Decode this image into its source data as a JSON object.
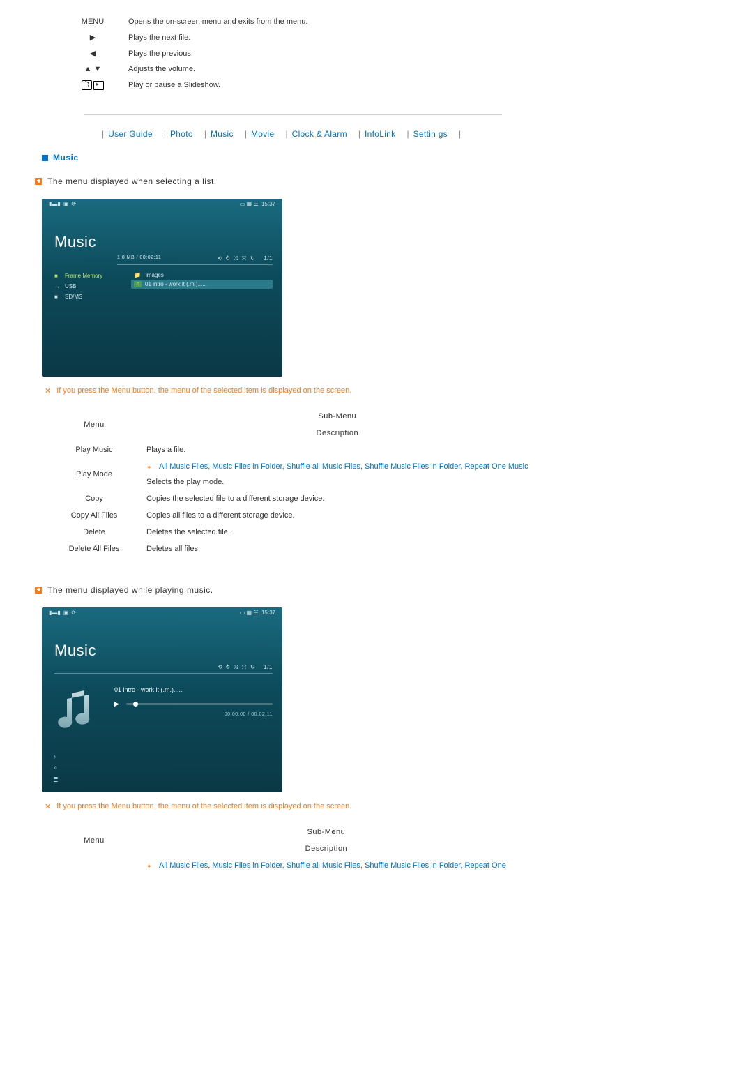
{
  "buttons_table": [
    {
      "icon_label": "MENU",
      "is_text": true,
      "desc": "Opens the on-screen menu and exits from the menu."
    },
    {
      "icon_label": "▶",
      "is_text": false,
      "name": "right-arrow-icon",
      "desc": "Plays the next file."
    },
    {
      "icon_label": "◀",
      "is_text": false,
      "name": "left-arrow-icon",
      "desc": "Plays the previous."
    },
    {
      "icon_label": "▲  ▼",
      "is_text": false,
      "name": "up-down-arrow-icon",
      "desc": "Adjusts the volume."
    },
    {
      "icon_label": "slideshow",
      "is_text": false,
      "name": "slideshow-icon",
      "desc": "Play or pause a Slideshow."
    }
  ],
  "nav": [
    "User Guide",
    "Photo",
    "Music",
    "Movie",
    "Clock & Alarm",
    "InfoLink",
    "Settin   gs"
  ],
  "section_title": "Music",
  "sub1": "The menu displayed when selecting a list.",
  "sub2": "The menu displayed while playing music.",
  "x_note": "If you press the Menu button, the menu of the selected item is displayed on the screen.",
  "screenshot_list": {
    "clock": "15:37",
    "title": "Music",
    "infobar_left": "1.8 MB / 00:02:11",
    "pager": "1/1",
    "sidebar": [
      {
        "label": "Frame Memory",
        "icon": "■",
        "active": true
      },
      {
        "label": "USB",
        "icon": "↔",
        "active": false
      },
      {
        "label": "SD/MS",
        "icon": "■",
        "active": false
      }
    ],
    "files": [
      {
        "label": "images",
        "icon": "📁",
        "sel": false
      },
      {
        "label": "01 intro - work it (.m.)......",
        "icon": "♫",
        "sel": true
      }
    ]
  },
  "screenshot_play": {
    "clock": "15:37",
    "title": "Music",
    "pager": "1/1",
    "track": "01 intro - work it (.m.).....",
    "time": "00:00:00 / 00:02:11"
  },
  "table1_header_menu": "Menu",
  "table1_header_sub": "Sub-Menu",
  "table1_header_desc": "Description",
  "table1_rows": [
    {
      "menu": "Play Music",
      "blue": "",
      "desc": "Plays a file."
    },
    {
      "menu": "Play Mode",
      "blue": "All Music Files, Music Files in Folder, Shuffle all Music Files, Shuffle Music Files in Folder, Repeat One Music",
      "desc": "Selects the play mode."
    },
    {
      "menu": "Copy",
      "blue": "",
      "desc": "Copies the selected file to a different storage device."
    },
    {
      "menu": "Copy All Files",
      "blue": "",
      "desc": "Copies all files to a different storage device."
    },
    {
      "menu": "Delete",
      "blue": "",
      "desc": "Deletes the selected file."
    },
    {
      "menu": "Delete All Files",
      "blue": "",
      "desc": "Deletes all files."
    }
  ],
  "table2_blue": "All Music Files, Music Files in Folder, Shuffle all Music Files, Shuffle Music Files in Folder, Repeat One"
}
